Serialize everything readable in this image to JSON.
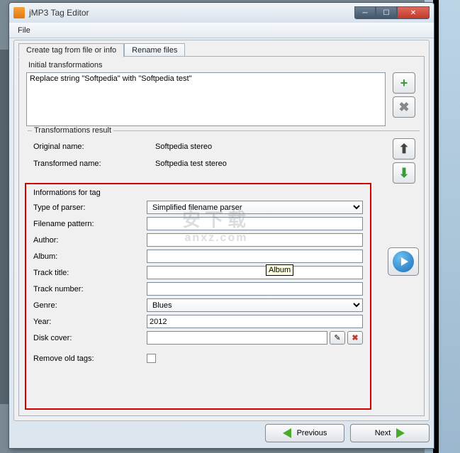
{
  "window": {
    "title": "jMP3 Tag Editor"
  },
  "menu": {
    "file": "File"
  },
  "tabs": {
    "create": "Create tag from file or info",
    "rename": "Rename files"
  },
  "initial": {
    "group": "Initial transformations",
    "rule": "Replace string \"Softpedia\" with \"Softpedia test\""
  },
  "result": {
    "group": "Transformations result",
    "orig_label": "Original name:",
    "orig_value": "Softpedia stereo",
    "trans_label": "Transformed name:",
    "trans_value": "Softpedia test stereo"
  },
  "info": {
    "group": "Informations for tag",
    "parser_label": "Type of parser:",
    "parser_value": "Simplified filename parser",
    "pattern_label": "Filename pattern:",
    "pattern_value": "",
    "author_label": "Author:",
    "author_value": "",
    "album_label": "Album:",
    "album_value": "",
    "title_label": "Track title:",
    "title_value": "",
    "number_label": "Track number:",
    "number_value": "",
    "genre_label": "Genre:",
    "genre_value": "Blues",
    "year_label": "Year:",
    "year_value": "2012",
    "disk_label": "Disk cover:",
    "disk_value": "",
    "remove_label": "Remove old tags:"
  },
  "tooltip": {
    "album": "Album"
  },
  "nav": {
    "prev": "Previous",
    "next": "Next"
  },
  "watermark": {
    "line1": "安下载",
    "line2": "anxz.com"
  },
  "icons": {
    "add": "+",
    "delete": "✖",
    "up": "⬆",
    "down": "⬇",
    "edit": "✎"
  }
}
